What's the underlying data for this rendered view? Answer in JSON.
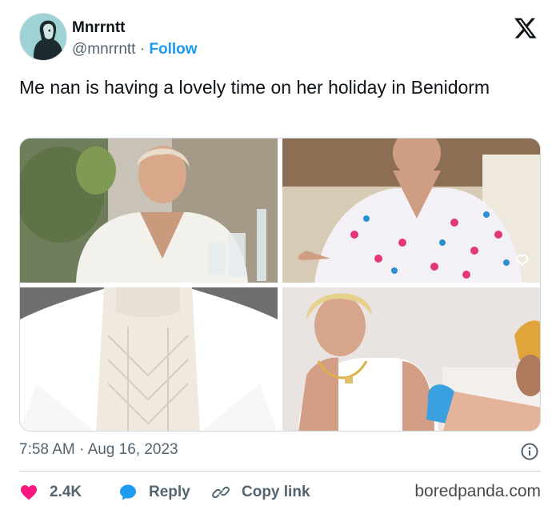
{
  "author": {
    "name": "Mnrrntt",
    "handle": "@mnrrntt",
    "separator": " · ",
    "follow_label": "Follow"
  },
  "tweet": {
    "text": "Me nan is having a lovely time on her holiday in Benidorm"
  },
  "meta": {
    "time": "7:58 AM",
    "separator": " · ",
    "date": "Aug 16, 2023"
  },
  "actions": {
    "likes": "2.4K",
    "reply_label": "Reply",
    "copy_label": "Copy link"
  },
  "watermark": "boredpanda.com",
  "colors": {
    "accent": "#1d9bf0",
    "like": "#f91880",
    "text": "#0f1419",
    "muted": "#536471"
  },
  "icons": {
    "logo": "x-logo-icon",
    "like": "heart-icon",
    "reply": "speech-bubble-icon",
    "copy": "link-icon",
    "info": "info-icon"
  }
}
